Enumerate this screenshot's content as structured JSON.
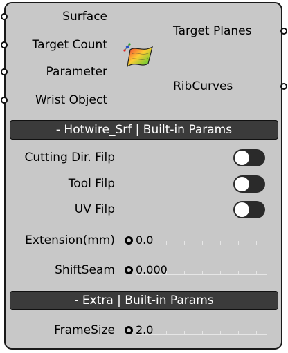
{
  "inputs": [
    "Surface",
    "Target Count",
    "Parameter",
    "Wrist Object"
  ],
  "outputs": [
    "Target Planes",
    "RibCurves"
  ],
  "component_icon": "surface-ribbon-icon",
  "sections": {
    "builtin": "- Hotwire_Srf | Built-in Params",
    "extra": "- Extra | Built-in Params"
  },
  "toggles": [
    {
      "label": "Cutting Dir. Filp",
      "on": false
    },
    {
      "label": "Tool Filp",
      "on": false
    },
    {
      "label": "UV Filp",
      "on": false
    }
  ],
  "sliders": [
    {
      "label": "Extension(mm)",
      "value": "0.0"
    },
    {
      "label": "ShiftSeam",
      "value": "0.000"
    },
    {
      "label": "FrameSize",
      "value": "2.0"
    }
  ],
  "colors": {
    "panel": "#c8c8c8",
    "header": "#3b3b3b",
    "toggle_track": "#2a2a2a"
  }
}
